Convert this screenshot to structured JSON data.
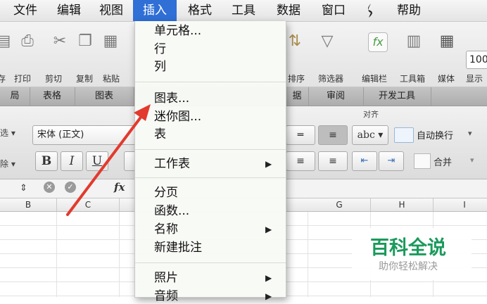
{
  "menubar": {
    "items": [
      "文件",
      "编辑",
      "视图",
      "插入",
      "格式",
      "工具",
      "数据",
      "窗口",
      "帮助"
    ],
    "active": "插入"
  },
  "toolbar": {
    "labels": [
      "存",
      "打印",
      "剪切",
      "复制",
      "粘贴",
      "排序",
      "筛选器",
      "编辑栏",
      "工具箱",
      "媒体",
      "显示"
    ],
    "zoom": "100"
  },
  "ribbon_tabs": [
    "局",
    "表格",
    "图表",
    "据",
    "审阅",
    "开发工具"
  ],
  "format": {
    "font_name": "宋体 (正文)",
    "bold": "B",
    "italic": "I",
    "underline": "U",
    "align_group": "对齐",
    "wrap_sample": "abc",
    "wrap_text": "自动换行",
    "merge": "合并"
  },
  "formula_bar": {
    "fx": "fx"
  },
  "columns": [
    "B",
    "C",
    "G",
    "H",
    "I"
  ],
  "dropdown": {
    "items": [
      {
        "label": "单元格...",
        "submenu": false
      },
      {
        "label": "行",
        "submenu": false
      },
      {
        "label": "列",
        "submenu": false
      },
      {
        "label": "图表...",
        "submenu": false
      },
      {
        "label": "迷你图...",
        "submenu": false
      },
      {
        "label": "表",
        "submenu": false
      },
      {
        "label": "工作表",
        "submenu": true
      },
      {
        "label": "分页",
        "submenu": false
      },
      {
        "label": "函数...",
        "submenu": false
      },
      {
        "label": "名称",
        "submenu": true
      },
      {
        "label": "新建批注",
        "submenu": false
      },
      {
        "label": "照片",
        "submenu": true
      },
      {
        "label": "音频",
        "submenu": true
      }
    ]
  },
  "watermark": {
    "title": "百科全说",
    "subtitle": "助你轻松解决"
  },
  "colors": {
    "menu_highlight": "#2f6fd6",
    "arrow": "#e23a2e",
    "watermark_green": "#1a9a5b"
  }
}
